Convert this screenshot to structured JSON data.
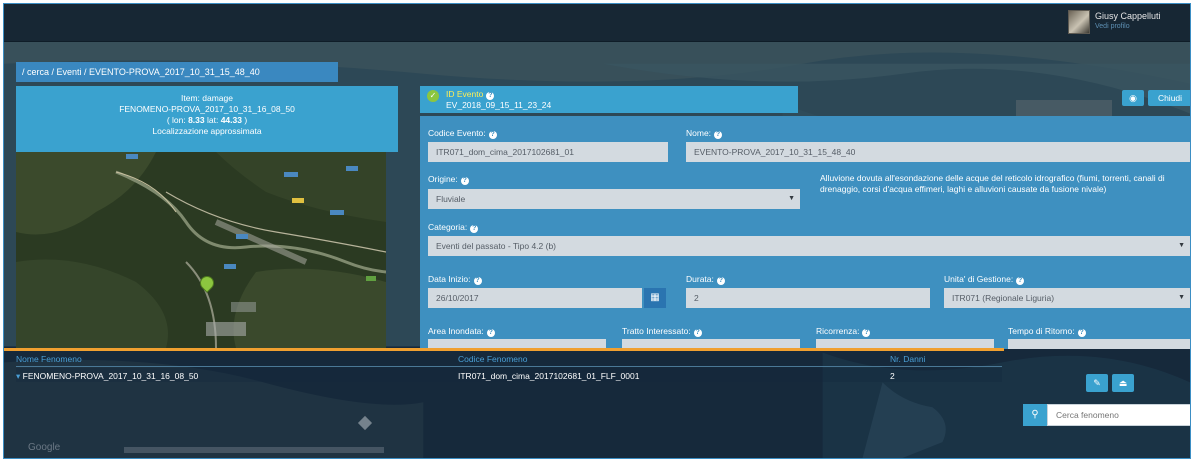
{
  "user": {
    "name": "Giusy Cappelluti",
    "role": "Vedi profilo"
  },
  "breadcrumb": "/ cerca  /  Eventi  /  EVENTO-PROVA_2017_10_31_15_48_40",
  "item_header": {
    "line1": "Item: damage",
    "line2": "FENOMENO-PROVA_2017_10_31_16_08_50",
    "lon_label": "( lon: ",
    "lon_value": "8.33",
    "lat_label": " lat: ",
    "lat_value": "44.33",
    "close_paren": " )",
    "line4": "Localizzazione approssimata"
  },
  "id_evento": {
    "label": "ID Evento",
    "value": "EV_2018_09_15_11_23_24"
  },
  "buttons": {
    "eye_icon": "eye-icon",
    "chiudi": "Chiudi",
    "edit_icon": "pencil-icon",
    "up_icon": "eject-icon",
    "calendar_icon": "calendar-icon",
    "search_icon": "search-icon"
  },
  "form": {
    "codice_evento_label": "Codice Evento:",
    "codice_evento_value": "ITR071_dom_cima_2017102681_01",
    "nome_label": "Nome:",
    "nome_value": "EVENTO-PROVA_2017_10_31_15_48_40",
    "origine_label": "Origine:",
    "origine_value": "Fluviale",
    "origine_description": "Alluvione dovuta all'esondazione delle acque del reticolo idrografico (fiumi, torrenti, canali di drenaggio, corsi d'acqua effimeri, laghi e alluvioni causate da fusione nivale)",
    "categoria_label": "Categoria:",
    "categoria_value": "Eventi del passato - Tipo 4.2 (b)",
    "data_inizio_label": "Data Inizio:",
    "data_inizio_value": "26/10/2017",
    "durata_label": "Durata:",
    "durata_value": "2",
    "unita_gestione_label": "Unita' di Gestione:",
    "unita_gestione_value": "ITR071 (Regionale Liguria)",
    "area_inondata_label": "Area Inondata:",
    "tratto_interessato_label": "Tratto Interessato:",
    "ricorrenza_label": "Ricorrenza:",
    "tempo_ritorno_label": "Tempo di Ritorno:"
  },
  "table": {
    "headers": [
      "Nome Fenomeno",
      "Codice Fenomeno",
      "Nr. Danni"
    ],
    "rows": [
      {
        "nome": "FENOMENO-PROVA_2017_10_31_16_08_50",
        "codice": "ITR071_dom_cima_2017102681_01_FLF_0001",
        "danni": "2"
      }
    ]
  },
  "search": {
    "placeholder": "Cerca fenomeno"
  },
  "map": {
    "attribution": "Google"
  },
  "colors": {
    "accent": "#3aa2cf",
    "form_bg": "#3e90c0",
    "divider": "#f0a030",
    "marker": "#8cc63f"
  }
}
